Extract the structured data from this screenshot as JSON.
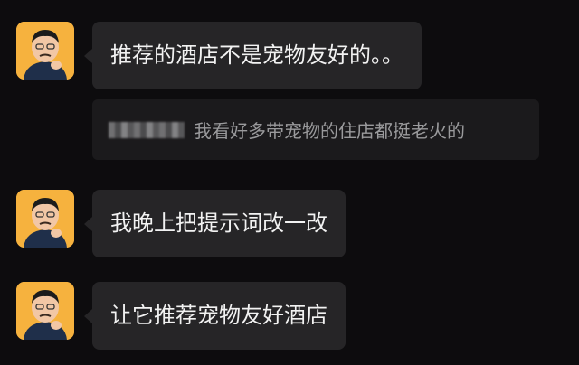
{
  "messages": [
    {
      "text": "推荐的酒店不是宠物友好的。。",
      "quote": {
        "sender": "",
        "text": "我看好多带宠物的住店都挺老火的"
      }
    },
    {
      "text": "我晚上把提示词改一改"
    },
    {
      "text": "让它推荐宠物友好酒店"
    }
  ],
  "avatar": {
    "icon": "cartoon-man-avatar-icon"
  },
  "colors": {
    "background": "#0d0c0e",
    "bubble": "#262527",
    "bubble_text": "#f2f2f2",
    "quote_bg": "#1b1a1c",
    "quote_text": "#9a9a9c",
    "avatar_bg": "#f6b23e"
  }
}
